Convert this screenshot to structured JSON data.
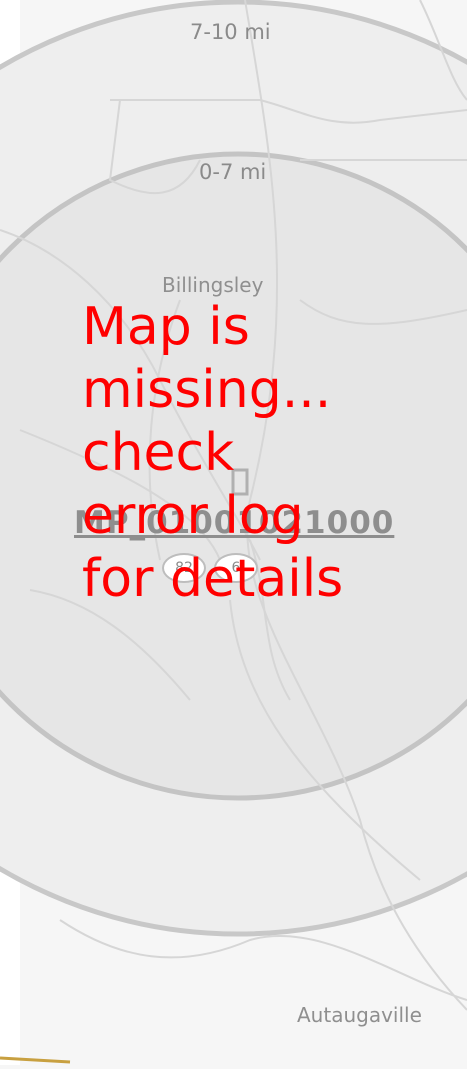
{
  "map": {
    "rings": [
      {
        "label": "7-10 mi"
      },
      {
        "label": "0-7 mi"
      }
    ],
    "places": [
      "Billingsley",
      "Autaugaville"
    ],
    "site_label": "MP_01001021000",
    "route_shields": [
      "82",
      "6"
    ]
  },
  "error_message": "Map is\nmissing...\ncheck\nerror log\nfor details",
  "colors": {
    "background": "#f6f6f6",
    "ring_fill": "#e6e6e6",
    "ring_stroke": "#c8c8c8",
    "roads": "#dcdcdc",
    "error_text": "#ff0000"
  }
}
